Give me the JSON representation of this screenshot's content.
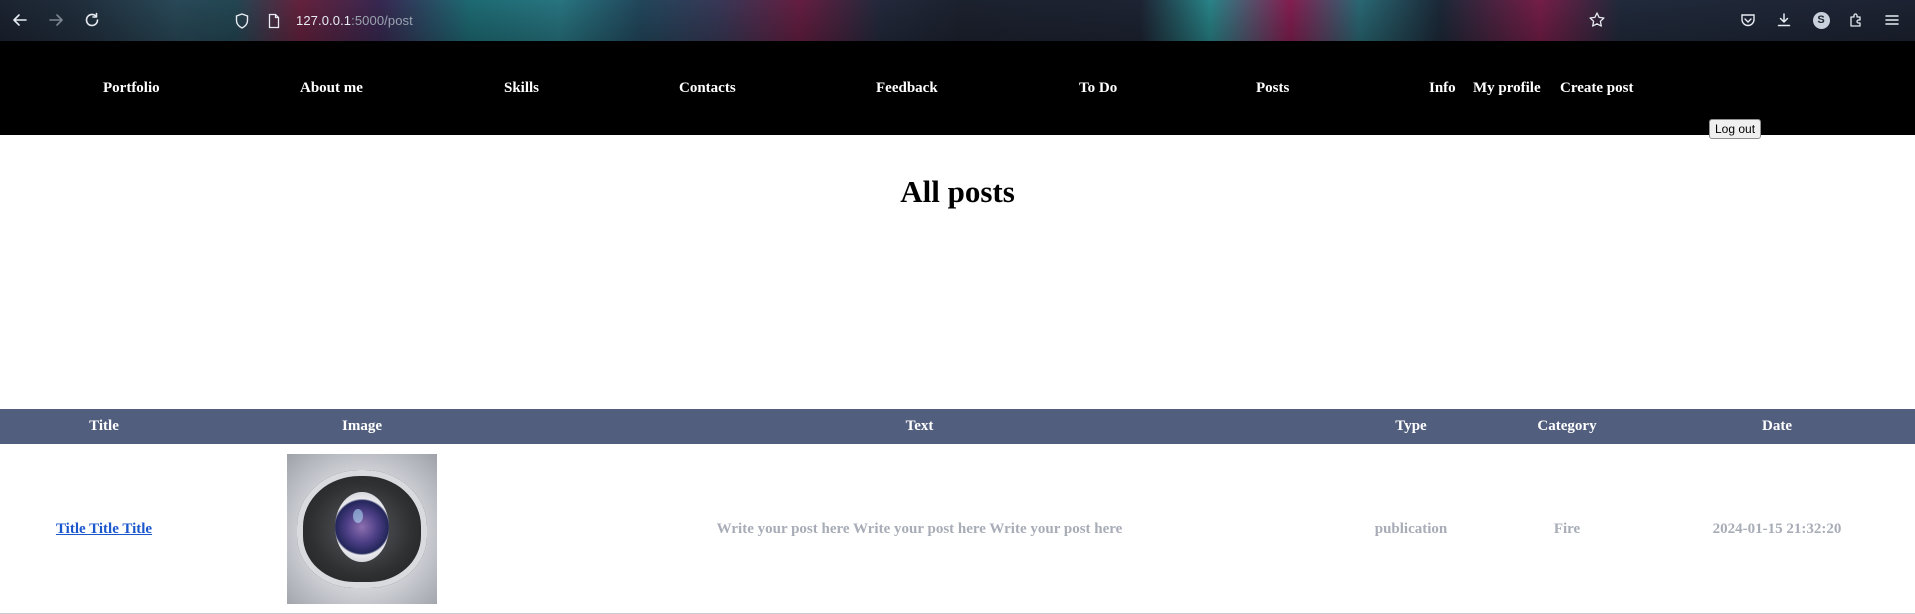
{
  "browser": {
    "url_host": "127.0.0.1",
    "url_path": ":5000/post",
    "profile_initial": "S"
  },
  "nav": {
    "links": [
      "Portfolio",
      "About me",
      "Skills",
      "Contacts",
      "Feedback",
      "To Do",
      "Posts",
      "Info",
      "My profile",
      "Create post"
    ],
    "logout_label": "Log out"
  },
  "page": {
    "title": "All posts"
  },
  "table": {
    "headers": [
      "Title",
      "Image",
      "Text",
      "Type",
      "Category",
      "Date"
    ],
    "rows": [
      {
        "title": "Title Title Title",
        "image": "robot-eye-image",
        "text": "Write your post here Write your post here Write your post here",
        "type": "publication",
        "category": "Fire",
        "date": "2024-01-15 21:32:20"
      }
    ]
  },
  "colors": {
    "nav_background": "#000000",
    "table_header_background": "#525e7e",
    "link_color": "#1a56cc",
    "muted_text": "#a7acb6"
  }
}
